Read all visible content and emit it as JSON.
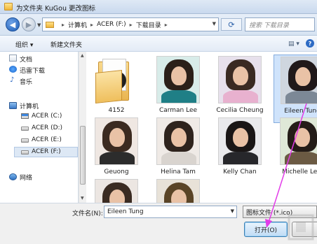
{
  "window": {
    "title": "为文件夹 KuGou 更改图标"
  },
  "address": {
    "crumbs": [
      "计算机",
      "ACER (F:)",
      "下载目录"
    ],
    "search_placeholder": "搜索 下载目录"
  },
  "toolbar": {
    "organize": "组织 ▾",
    "new_folder": "新建文件夹",
    "view_icon": "views-icon",
    "help_icon": "help-icon"
  },
  "sidebar": {
    "items": [
      {
        "label": "文档",
        "icon": "documents-icon"
      },
      {
        "label": "迅雷下载",
        "icon": "thunder-icon"
      },
      {
        "label": "音乐",
        "icon": "music-icon"
      },
      {
        "label": "计算机",
        "icon": "computer-icon"
      },
      {
        "label": "ACER (C:)",
        "icon": "drive-icon"
      },
      {
        "label": "ACER (D:)",
        "icon": "drive-icon"
      },
      {
        "label": "ACER (E:)",
        "icon": "drive-icon"
      },
      {
        "label": "ACER (F:)",
        "icon": "drive-icon",
        "selected": true
      },
      {
        "label": "网络",
        "icon": "network-icon"
      }
    ]
  },
  "files": [
    {
      "label": "4152",
      "kind": "folder"
    },
    {
      "label": "Carman Lee",
      "kind": "icon"
    },
    {
      "label": "Cecilia Cheung",
      "kind": "icon"
    },
    {
      "label": "Eileen Tung",
      "kind": "icon",
      "selected": true
    },
    {
      "label": "Geuong",
      "kind": "icon"
    },
    {
      "label": "Helina Tam",
      "kind": "icon"
    },
    {
      "label": "Kelly Chan",
      "kind": "icon"
    },
    {
      "label": "Michelle Lee",
      "kind": "icon"
    },
    {
      "label": "",
      "kind": "icon"
    },
    {
      "label": "",
      "kind": "icon"
    }
  ],
  "footer": {
    "filename_label": "文件名(N):",
    "filename_value": "Eileen Tung",
    "filetype_value": "图标文件 (*.ico)",
    "open_label": "打开(O)"
  },
  "colors": {
    "accent": "#2d6bc4",
    "pointer": "#e23ce8",
    "selection": "#cfe3fb"
  }
}
